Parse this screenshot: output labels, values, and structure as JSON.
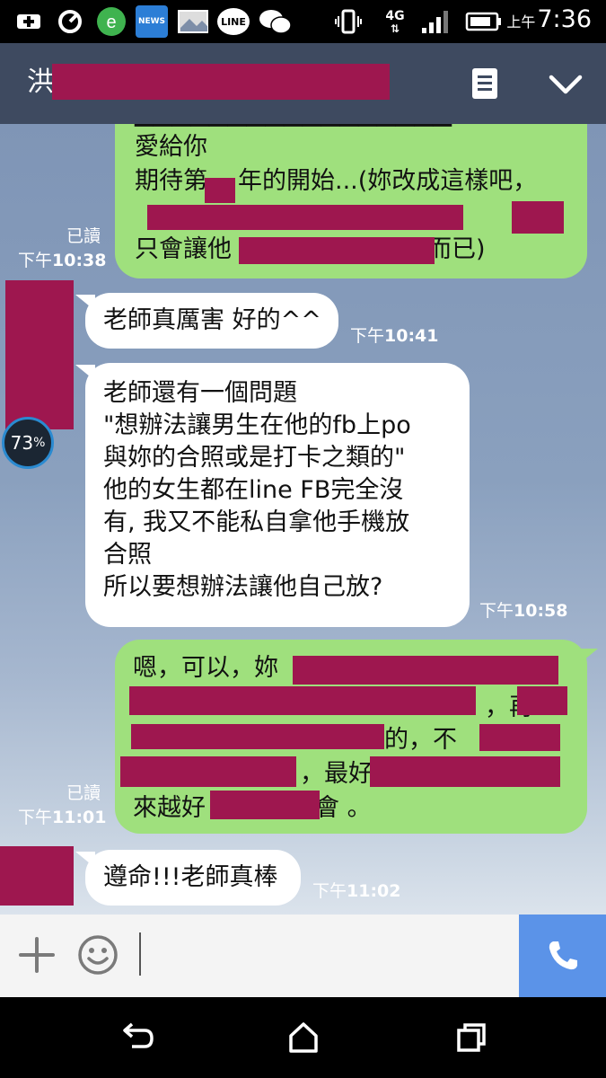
{
  "status_bar": {
    "news_label": "NEWS",
    "line_label": "LINE",
    "network": "4G",
    "ampm": "上午",
    "time": "7:36"
  },
  "header": {
    "title_char": "洪"
  },
  "messages": [
    {
      "lines": [
        "愛給你",
        "期待第",
        "年的開始...(妳改成這樣吧，",
        "只會讓他",
        "而已)"
      ],
      "read": "已讀",
      "ampm": "下午",
      "time": "10:38"
    },
    {
      "text": "老師真厲害 好的^^",
      "ampm": "下午",
      "time": "10:41"
    },
    {
      "lines": [
        "老師還有一個問題",
        "\"想辦法讓男生在他的fb上po",
        "與妳的合照或是打卡之類的\"",
        "他的女生都在line  FB完全沒",
        "有, 我又不能私自拿他手機放",
        "合照",
        "所以要想辦法讓他自己放?"
      ],
      "ampm": "下午",
      "time": "10:58"
    },
    {
      "lines": [
        "嗯，可以，妳",
        "，再",
        "的，不",
        "，最好",
        "來越好",
        "會 。"
      ],
      "read": "已讀",
      "ampm": "下午",
      "time": "11:01"
    },
    {
      "text": "遵命!!!老師真棒",
      "ampm": "下午",
      "time": "11:02"
    }
  ],
  "badge": {
    "value": "73",
    "unit": "%"
  },
  "colors": {
    "header_bg": "#3e4a60",
    "my_bubble": "#9fe07d",
    "their_bubble": "#ffffff",
    "redaction": "#9e174f",
    "call_button": "#5b93e8"
  }
}
